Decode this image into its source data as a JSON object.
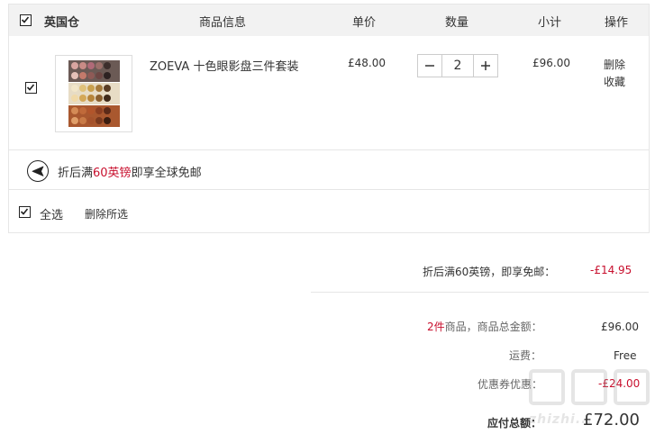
{
  "header": {
    "store_name": "英国仓",
    "col_info": "商品信息",
    "col_price": "单价",
    "col_qty": "数量",
    "col_subtotal": "小计",
    "col_action": "操作"
  },
  "item": {
    "name": "ZOEVA 十色眼影盘三件套装",
    "unit_price": "£48.00",
    "quantity": "2",
    "subtotal": "£96.00",
    "delete_label": "删除",
    "favorite_label": "收藏",
    "checked": true
  },
  "promo": {
    "text_before": "折后满",
    "highlight": "60英镑",
    "text_after": "即享全球免邮"
  },
  "footer": {
    "select_all_label": "全选",
    "delete_selected_label": "删除所选"
  },
  "summary": {
    "discount_label": "折后满60英镑，即享免邮：",
    "discount_value": "-£14.95",
    "count_value": "2件",
    "count_label": "商品，商品总金额：",
    "goods_total": "£96.00",
    "shipping_label": "运费：",
    "shipping_value": "Free",
    "coupon_label": "优惠券优惠：",
    "coupon_value": "-£24.00",
    "payable_label": "应付总额：",
    "payable_value": "£72.00"
  },
  "watermark": {
    "text": "zhizhi..."
  },
  "colors": {
    "accent_red": "#c8102e",
    "header_bg": "#f2f2f2",
    "border": "#e6e6e6"
  }
}
